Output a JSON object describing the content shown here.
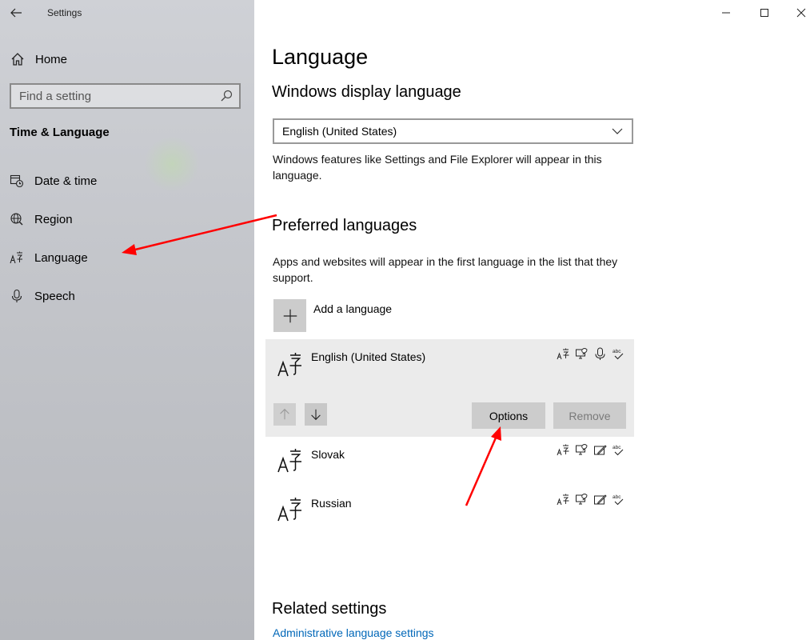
{
  "window": {
    "title": "Settings"
  },
  "sidebar": {
    "home_label": "Home",
    "search_placeholder": "Find a setting",
    "section_label": "Time & Language",
    "items": [
      {
        "label": "Date & time",
        "icon": "calendar-clock-icon"
      },
      {
        "label": "Region",
        "icon": "globe-icon"
      },
      {
        "label": "Language",
        "icon": "language-icon"
      },
      {
        "label": "Speech",
        "icon": "microphone-icon"
      }
    ]
  },
  "main": {
    "page_title": "Language",
    "display_language": {
      "heading": "Windows display language",
      "selected": "English (United States)",
      "description": "Windows features like Settings and File Explorer will appear in this language."
    },
    "preferred": {
      "heading": "Preferred languages",
      "description": "Apps and websites will appear in the first language in the list that they support.",
      "add_label": "Add a language",
      "languages": [
        {
          "name": "English (United States)",
          "features": [
            "language-pack-icon",
            "display-icon",
            "microphone-icon",
            "spellcheck-icon"
          ]
        },
        {
          "name": "Slovak",
          "features": [
            "language-pack-icon",
            "display-icon",
            "handwriting-icon",
            "spellcheck-icon"
          ]
        },
        {
          "name": "Russian",
          "features": [
            "language-pack-icon",
            "display-icon",
            "handwriting-icon",
            "spellcheck-icon"
          ]
        }
      ],
      "options_label": "Options",
      "remove_label": "Remove"
    },
    "related": {
      "heading": "Related settings",
      "link": "Administrative language settings"
    }
  },
  "colors": {
    "link": "#0067b8",
    "annotation_arrow": "#ff0000",
    "sidebar_bg": "#c4c6cb"
  }
}
